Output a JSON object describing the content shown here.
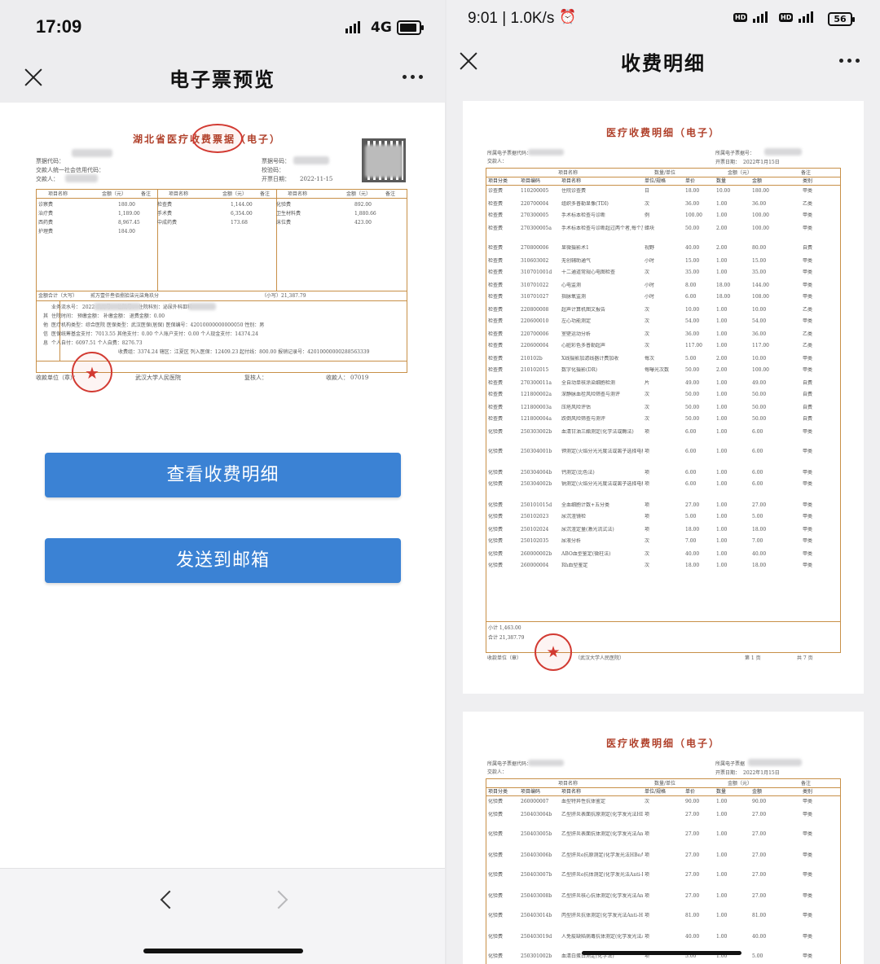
{
  "left": {
    "status": {
      "time": "17:09",
      "network": "4G"
    },
    "nav": {
      "title": "电子票预览"
    },
    "invoice": {
      "title": "湖北省医疗收费票据（电子）",
      "code_label": "票据代码：",
      "payer_label": "交款人统一社会信用代码：",
      "payer_name_label": "交款人：",
      "number_label": "票据号码：",
      "check_label": "校验码：",
      "date_label": "开票日期：",
      "date_value": "2022-11-15",
      "col_headers": [
        "项目名称",
        "金额（元）",
        "备注",
        "项目名称",
        "金额（元）",
        "备注",
        "项目名称",
        "金额（元）",
        "备注"
      ],
      "items": [
        [
          "诊察费",
          "180.00",
          "检查费",
          "1,144.00",
          "化验费",
          "892.00"
        ],
        [
          "治疗费",
          "1,189.00",
          "手术费",
          "6,354.00",
          "卫生材料费",
          "1,880.66"
        ],
        [
          "西药费",
          "8,967.45",
          "中成药费",
          "173.68",
          "床位费",
          "423.00"
        ],
        [
          "护理费",
          "184.00",
          "",
          "",
          "",
          ""
        ]
      ],
      "total_label": "金额合计（大写）",
      "total_upper": "贰万壹仟叁佰捌拾柒元柒角玖分",
      "total_lower": "（小写）21,387.79",
      "other_lines": [
        "业务流水号：        2022     病历号：            住院号：            住院科别：泌尿外科Ⅲ科",
        "住院时间：                    预缴金额：          补缴金额：          退费金额：0.00",
        "医疗机构类型：综合医院        医保类型：武汉医保(居保)  医保编号：42010000000000050  性别：男",
        "医保统筹基金支付：7013.55     其他支付：0.00      个人账户支付：0.00  个人现金支付：14374.24",
        "个人自付：6097.51             个人自费：8276.73",
        "收费组：3374.24 辖区：江夏区 列入医保：12409.23 起付线：800.00 报销记录号：42010000000288563339"
      ],
      "remark_label": "其他信息",
      "unit_label": "收款单位（章）：",
      "unit_value": "武汉大学人民医院",
      "reviewer_label": "复核人：",
      "payee_label": "收款人：",
      "payee_value": "07019"
    },
    "buttons": {
      "view_details": "查看收费明细",
      "send_email": "发送到邮箱"
    }
  },
  "right": {
    "status": {
      "time": "9:01 | 1.0K/s",
      "battery": "56"
    },
    "nav": {
      "title": "收费明细"
    },
    "page1": {
      "title": "医疗收费明细（电子）",
      "code_label": "所属电子票据代码：",
      "number_label": "所属电子票据号：",
      "payer_label": "交款人：",
      "date_label": "开票日期：",
      "date_value": "2022年1月15日",
      "group_headers": [
        "项目名称",
        "数量/单位",
        "金额（元）",
        "备注"
      ],
      "col_headers": [
        "项目分类",
        "项目编码",
        "项目名称",
        "单位/规格",
        "单价",
        "数量",
        "金额",
        "类别"
      ],
      "rows": [
        [
          "诊查费",
          "110200005",
          "住院诊查费",
          "日",
          "18.00",
          "10.00",
          "180.00",
          "甲类"
        ],
        [
          "检查费",
          "220700004",
          "组织多普勒显像(TDI)",
          "次",
          "36.00",
          "1.00",
          "36.00",
          "乙类"
        ],
        [
          "检查费",
          "270300005",
          "手术标本检查与诊断",
          "例",
          "100.00",
          "1.00",
          "100.00",
          "甲类"
        ],
        [
          "检查费",
          "270300005a",
          "手术标本检查与诊断超过两个者,每个加收",
          "蜡块",
          "50.00",
          "2.00",
          "100.00",
          "甲类"
        ],
        [
          "检查费",
          "270800006",
          "显微摄影术1",
          "视野",
          "40.00",
          "2.00",
          "80.00",
          "自费"
        ],
        [
          "检查费",
          "310603002",
          "无创辅助通气",
          "小时",
          "15.00",
          "1.00",
          "15.00",
          "甲类"
        ],
        [
          "检查费",
          "310701001d",
          "十二通道常规心电图检查",
          "次",
          "35.00",
          "1.00",
          "35.00",
          "甲类"
        ],
        [
          "检查费",
          "310701022",
          "心电监测",
          "小时",
          "8.00",
          "18.00",
          "144.00",
          "甲类"
        ],
        [
          "检查费",
          "310701027",
          "指脉氧监测",
          "小时",
          "6.00",
          "18.00",
          "108.00",
          "甲类"
        ],
        [
          "检查费",
          "220800008",
          "超声计算机图文报告",
          "次",
          "10.00",
          "1.00",
          "10.00",
          "乙类"
        ],
        [
          "检查费",
          "220600010",
          "左心功能测定",
          "次",
          "54.00",
          "1.00",
          "54.00",
          "甲类"
        ],
        [
          "检查费",
          "220700006",
          "室壁运动分析",
          "次",
          "36.00",
          "1.00",
          "36.00",
          "乙类"
        ],
        [
          "检查费",
          "220600004",
          "心脏彩色多普勒超声",
          "次",
          "117.00",
          "1.00",
          "117.00",
          "乙类"
        ],
        [
          "检查费",
          "210102b",
          "X线摄影加滤线器计费加收",
          "每次",
          "5.00",
          "2.00",
          "10.00",
          "甲类"
        ],
        [
          "检查费",
          "210102015",
          "数字化摄影(DR)",
          "每曝光次数",
          "50.00",
          "2.00",
          "100.00",
          "甲类"
        ],
        [
          "检查费",
          "270300011a",
          "全自动单核涂染细胞检测",
          "片",
          "49.00",
          "1.00",
          "49.00",
          "自费"
        ],
        [
          "检查费",
          "121800002a",
          "深静脉血栓风险筛查与测评",
          "次",
          "50.00",
          "1.00",
          "50.00",
          "自费"
        ],
        [
          "检查费",
          "121800003a",
          "压疮风险评估",
          "次",
          "50.00",
          "1.00",
          "50.00",
          "自费"
        ],
        [
          "检查费",
          "121800004a",
          "跌倒风险筛查与测评",
          "次",
          "50.00",
          "1.00",
          "50.00",
          "自费"
        ],
        [
          "化验费",
          "250303002b",
          "血清甘油三酯测定(化学法或酶法)",
          "项",
          "6.00",
          "1.00",
          "6.00",
          "甲类"
        ],
        [
          "化验费",
          "250304001b",
          "钾测定(火焰分光光度法或离子选择电极法)",
          "项",
          "6.00",
          "1.00",
          "6.00",
          "甲类"
        ],
        [
          "化验费",
          "250304004b",
          "钙测定(比色法)",
          "项",
          "6.00",
          "1.00",
          "6.00",
          "甲类"
        ],
        [
          "化验费",
          "250304002b",
          "钠测定(火焰分光光度法或离子选择电极法)",
          "项",
          "6.00",
          "1.00",
          "6.00",
          "甲类"
        ],
        [
          "化验费",
          "250101015d",
          "全血细胞计数+五分类",
          "项",
          "27.00",
          "1.00",
          "27.00",
          "甲类"
        ],
        [
          "化验费",
          "250102023",
          "尿沉渣镜检",
          "项",
          "5.00",
          "1.00",
          "5.00",
          "甲类"
        ],
        [
          "化验费",
          "250102024",
          "尿沉渣定量(激光流式法)",
          "项",
          "18.00",
          "1.00",
          "18.00",
          "甲类"
        ],
        [
          "化验费",
          "250102035",
          "尿液分析",
          "次",
          "7.00",
          "1.00",
          "7.00",
          "甲类"
        ],
        [
          "化验费",
          "260000002b",
          "ABO血型鉴定(微柱法)",
          "次",
          "40.00",
          "1.00",
          "40.00",
          "甲类"
        ],
        [
          "化验费",
          "260000004",
          "Rh血型鉴定",
          "次",
          "18.00",
          "1.00",
          "18.00",
          "甲类"
        ]
      ],
      "subtotal": "小计 1,463.00",
      "total": "合计 21,387.79",
      "unit_label": "收款单位（章）",
      "unit_value": "（武汉大学人民医院）",
      "page_label": "第    1    页",
      "pages_label": "共    7    页"
    },
    "page2": {
      "title": "医疗收费明细（电子）",
      "code_label": "所属电子票据代码：",
      "number_label": "所属电子票据",
      "payer_label": "交款人：",
      "date_label": "开票日期：",
      "date_value": "2022年1月15日",
      "group_headers": [
        "项目名称",
        "数量/单位",
        "金额（元）",
        "备注"
      ],
      "col_headers": [
        "项目分类",
        "项目编码",
        "项目名称",
        "单位/规格",
        "单价",
        "数量",
        "金额",
        "类别"
      ],
      "rows": [
        [
          "化验费",
          "260000007",
          "血型特异性抗体鉴定",
          "次",
          "90.00",
          "1.00",
          "90.00",
          "甲类"
        ],
        [
          "化验费",
          "250403004b",
          "乙型肝炎表面抗原测定(化学发光法HBsAg)",
          "项",
          "27.00",
          "1.00",
          "27.00",
          "甲类"
        ],
        [
          "化验费",
          "250403005b",
          "乙型肝炎表面抗体测定(化学发光法Anti-HBs)",
          "项",
          "27.00",
          "1.00",
          "27.00",
          "甲类"
        ],
        [
          "化验费",
          "250403006b",
          "乙型肝炎e抗原测定(化学发光法HBeAg)",
          "项",
          "27.00",
          "1.00",
          "27.00",
          "甲类"
        ],
        [
          "化验费",
          "250403007b",
          "乙型肝炎e抗体测定(化学发光法Anti-HBe)",
          "项",
          "27.00",
          "1.00",
          "27.00",
          "甲类"
        ],
        [
          "化验费",
          "250403008b",
          "乙型肝炎核心抗体测定(化学发光法Anti-HBc)",
          "项",
          "27.00",
          "1.00",
          "27.00",
          "甲类"
        ],
        [
          "化验费",
          "250403014b",
          "丙型肝炎抗体测定(化学发光法Anti-HCV)",
          "项",
          "81.00",
          "1.00",
          "81.00",
          "甲类"
        ],
        [
          "化验费",
          "250403019d",
          "人免疫缺陷病毒抗体测定(化学发光法Anti-HIV)",
          "项",
          "40.00",
          "1.00",
          "40.00",
          "甲类"
        ],
        [
          "化验费",
          "250301002b",
          "血清白蛋白测定(化学法)",
          "项",
          "5.00",
          "1.00",
          "5.00",
          "甲类"
        ],
        [
          "化验费",
          "250302001a",
          "氨基酸测定(各种酶法)",
          "项",
          "5.00",
          "1.00",
          "5.00",
          "甲类"
        ]
      ]
    }
  }
}
